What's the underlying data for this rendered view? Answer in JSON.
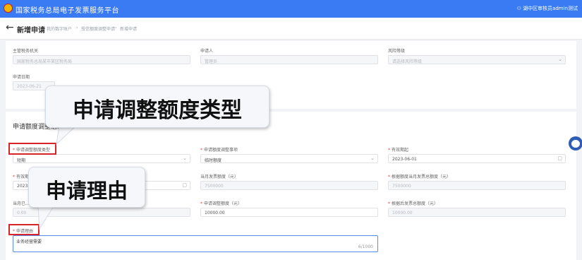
{
  "header": {
    "app_title": "国家税务总局电子发票服务平台",
    "user": "湖中区审核员admin测试"
  },
  "page": {
    "title": "新增申请",
    "breadcrumbs": [
      "我的数字账户",
      "授信额度调整申请",
      "新增申请"
    ]
  },
  "basic_info": {
    "tax_authority": {
      "label": "主管税务机关",
      "value": "国家税务总局某市某区税务局"
    },
    "applicant": {
      "label": "申请人",
      "value": "管理员"
    },
    "risk_level": {
      "label": "风险等级",
      "placeholder": "请选择风险等级"
    },
    "apply_date": {
      "label": "申请日期",
      "value": "2023-06-21"
    }
  },
  "section": {
    "title": "申请额度调整信息"
  },
  "fields": {
    "adjust_type": {
      "label": "申请调整额度类型",
      "value": "短期"
    },
    "adjust_reason": {
      "label": "申请额度调整事项",
      "value": "临时额度"
    },
    "valid_date": {
      "label": "有效期起",
      "value": "2023-06-01"
    },
    "start_date": {
      "label": "有效期止",
      "value": "2023-..."
    },
    "current_limit": {
      "label": "当月发票额度（元）",
      "value": "7500000"
    },
    "month_limit": {
      "label": "根据额度当月发票总额度（元）",
      "value": "7500000"
    },
    "remaining": {
      "label": "当月已...",
      "value": "0.00"
    },
    "apply_limit": {
      "label": "申请调整额度（元）",
      "value": "10000.00"
    },
    "total_after": {
      "label": "根据后发票总额度（元）",
      "value": "10000.00"
    },
    "reason_text": {
      "label": "申请理由",
      "value": "业务经营需要",
      "counter": "6/1000"
    }
  },
  "callouts": {
    "adjust_type": "申请调整额度类型",
    "reason": "申请理由"
  },
  "icons": {
    "calendar": "▢",
    "chevron": "⌄",
    "back": "←"
  }
}
